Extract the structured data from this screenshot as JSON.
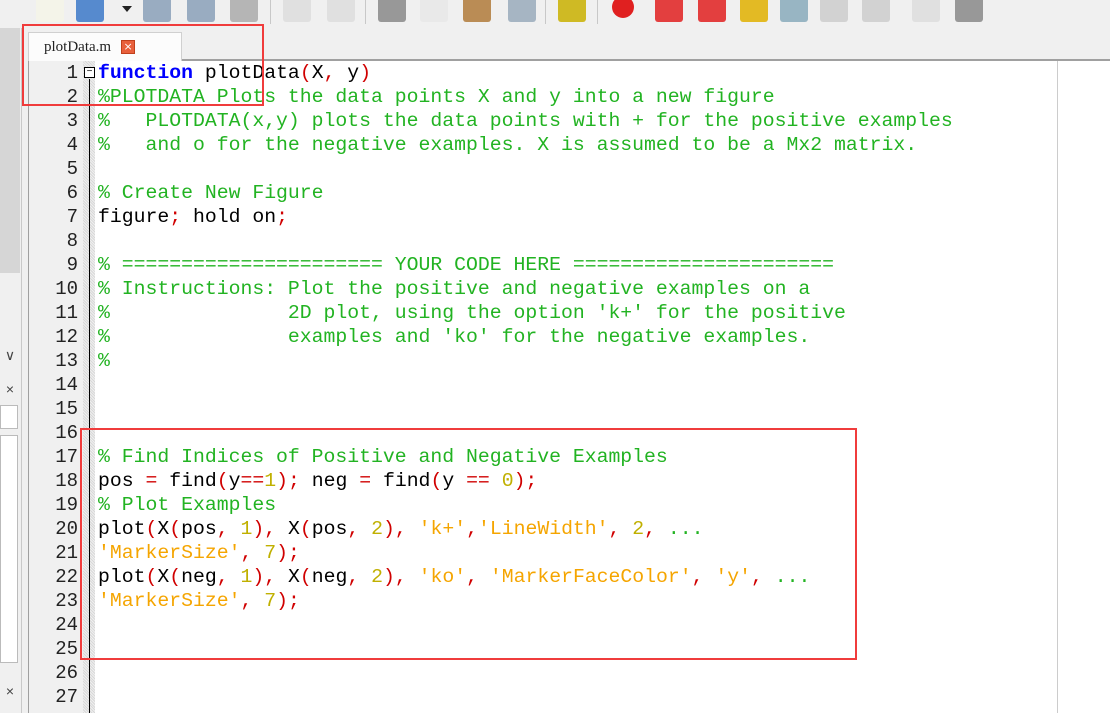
{
  "toolbar": {
    "icons": [
      "new-file-icon",
      "open-folder-icon",
      "dropdown-arrow-icon",
      "save-icon",
      "save-all-icon",
      "print-icon",
      "undo-icon",
      "redo-icon",
      "cut-icon",
      "copy-icon",
      "paste-icon",
      "find-icon",
      "run-icon",
      "breakpoint-icon",
      "prev-breakpoint-icon",
      "next-breakpoint-icon",
      "clear-breakpoints-icon",
      "step-icon",
      "step-in-icon",
      "step-out-icon",
      "continue-icon",
      "stop-icon"
    ]
  },
  "tab": {
    "label": "plotData.m",
    "close": "×"
  },
  "fold": {
    "symbol": "−"
  },
  "left_panel": {
    "up": "∧",
    "down": "∨",
    "close1": "×",
    "close2": "×"
  },
  "colors": {
    "keyword": "#0000ff",
    "comment": "#22b322",
    "string": "#f5a500",
    "number": "#c0b000",
    "operator": "#d00000",
    "highlight": "#f03c3c"
  },
  "editor": {
    "lines": [
      {
        "n": "1",
        "t": [
          [
            "k",
            "function"
          ],
          [
            "p",
            " plotData"
          ],
          [
            "o",
            "("
          ],
          [
            "p",
            "X"
          ],
          [
            "o",
            ","
          ],
          [
            "p",
            " y"
          ],
          [
            "o",
            ")"
          ]
        ]
      },
      {
        "n": "2",
        "t": [
          [
            "c",
            "%PLOTDATA Plots the data points X and y into a new figure"
          ]
        ]
      },
      {
        "n": "3",
        "t": [
          [
            "c",
            "%   PLOTDATA(x,y) plots the data points with + for the positive examples"
          ]
        ]
      },
      {
        "n": "4",
        "t": [
          [
            "c",
            "%   and o for the negative examples. X is assumed to be a Mx2 matrix."
          ]
        ]
      },
      {
        "n": "5",
        "t": []
      },
      {
        "n": "6",
        "t": [
          [
            "c",
            "% Create New Figure"
          ]
        ]
      },
      {
        "n": "7",
        "t": [
          [
            "p",
            "figure"
          ],
          [
            "o",
            ";"
          ],
          [
            "p",
            " hold on"
          ],
          [
            "o",
            ";"
          ]
        ]
      },
      {
        "n": "8",
        "t": []
      },
      {
        "n": "9",
        "t": [
          [
            "c",
            "% ====================== YOUR CODE HERE ======================"
          ]
        ]
      },
      {
        "n": "10",
        "t": [
          [
            "c",
            "% Instructions: Plot the positive and negative examples on a"
          ]
        ]
      },
      {
        "n": "11",
        "t": [
          [
            "c",
            "%               2D plot, using the option 'k+' for the positive"
          ]
        ]
      },
      {
        "n": "12",
        "t": [
          [
            "c",
            "%               examples and 'ko' for the negative examples."
          ]
        ]
      },
      {
        "n": "13",
        "t": [
          [
            "c",
            "%"
          ]
        ]
      },
      {
        "n": "14",
        "t": []
      },
      {
        "n": "15",
        "t": []
      },
      {
        "n": "16",
        "t": []
      },
      {
        "n": "17",
        "t": [
          [
            "c",
            "% Find Indices of Positive and Negative Examples"
          ]
        ]
      },
      {
        "n": "18",
        "t": [
          [
            "p",
            "pos "
          ],
          [
            "o",
            "="
          ],
          [
            "p",
            " find"
          ],
          [
            "o",
            "("
          ],
          [
            "p",
            "y"
          ],
          [
            "o",
            "=="
          ],
          [
            "n",
            "1"
          ],
          [
            "o",
            ");"
          ],
          [
            "p",
            " neg "
          ],
          [
            "o",
            "="
          ],
          [
            "p",
            " find"
          ],
          [
            "o",
            "("
          ],
          [
            "p",
            "y "
          ],
          [
            "o",
            "=="
          ],
          [
            "p",
            " "
          ],
          [
            "n",
            "0"
          ],
          [
            "o",
            ");"
          ]
        ]
      },
      {
        "n": "19",
        "t": [
          [
            "c",
            "% Plot Examples"
          ]
        ]
      },
      {
        "n": "20",
        "t": [
          [
            "p",
            "plot"
          ],
          [
            "o",
            "("
          ],
          [
            "p",
            "X"
          ],
          [
            "o",
            "("
          ],
          [
            "p",
            "pos"
          ],
          [
            "o",
            ","
          ],
          [
            "p",
            " "
          ],
          [
            "n",
            "1"
          ],
          [
            "o",
            "),"
          ],
          [
            "p",
            " X"
          ],
          [
            "o",
            "("
          ],
          [
            "p",
            "pos"
          ],
          [
            "o",
            ","
          ],
          [
            "p",
            " "
          ],
          [
            "n",
            "2"
          ],
          [
            "o",
            "),"
          ],
          [
            "p",
            " "
          ],
          [
            "s",
            "'k+'"
          ],
          [
            "o",
            ","
          ],
          [
            "s",
            "'LineWidth'"
          ],
          [
            "o",
            ","
          ],
          [
            "p",
            " "
          ],
          [
            "n",
            "2"
          ],
          [
            "o",
            ","
          ],
          [
            "p",
            " "
          ],
          [
            "c",
            "..."
          ]
        ]
      },
      {
        "n": "21",
        "t": [
          [
            "s",
            "'MarkerSize'"
          ],
          [
            "o",
            ","
          ],
          [
            "p",
            " "
          ],
          [
            "n",
            "7"
          ],
          [
            "o",
            ");"
          ]
        ]
      },
      {
        "n": "22",
        "t": [
          [
            "p",
            "plot"
          ],
          [
            "o",
            "("
          ],
          [
            "p",
            "X"
          ],
          [
            "o",
            "("
          ],
          [
            "p",
            "neg"
          ],
          [
            "o",
            ","
          ],
          [
            "p",
            " "
          ],
          [
            "n",
            "1"
          ],
          [
            "o",
            "),"
          ],
          [
            "p",
            " X"
          ],
          [
            "o",
            "("
          ],
          [
            "p",
            "neg"
          ],
          [
            "o",
            ","
          ],
          [
            "p",
            " "
          ],
          [
            "n",
            "2"
          ],
          [
            "o",
            "),"
          ],
          [
            "p",
            " "
          ],
          [
            "s",
            "'ko'"
          ],
          [
            "o",
            ","
          ],
          [
            "p",
            " "
          ],
          [
            "s",
            "'MarkerFaceColor'"
          ],
          [
            "o",
            ","
          ],
          [
            "p",
            " "
          ],
          [
            "s",
            "'y'"
          ],
          [
            "o",
            ","
          ],
          [
            "p",
            " "
          ],
          [
            "c",
            "..."
          ]
        ]
      },
      {
        "n": "23",
        "t": [
          [
            "s",
            "'MarkerSize'"
          ],
          [
            "o",
            ","
          ],
          [
            "p",
            " "
          ],
          [
            "n",
            "7"
          ],
          [
            "o",
            ");"
          ]
        ]
      },
      {
        "n": "24",
        "t": []
      },
      {
        "n": "25",
        "t": []
      },
      {
        "n": "26",
        "t": []
      },
      {
        "n": "27",
        "t": []
      }
    ]
  }
}
